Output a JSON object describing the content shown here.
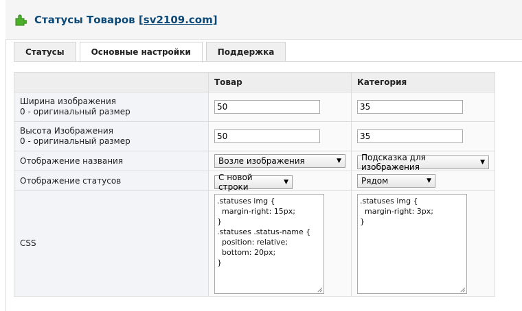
{
  "header": {
    "title": "Статусы Товаров",
    "link": "[sv2109.com]"
  },
  "tabs": [
    {
      "label": "Статусы",
      "active": false
    },
    {
      "label": "Основные настройки",
      "active": true
    },
    {
      "label": "Поддержка",
      "active": false
    }
  ],
  "table": {
    "columns": [
      "",
      "Товар",
      "Категория"
    ],
    "rows": {
      "width": {
        "label1": "Ширина изображения",
        "label2": "0 - оригинальный размер",
        "product": "50",
        "category": "35"
      },
      "height": {
        "label1": "Высота Изображения",
        "label2": "0 - оригинальный размер",
        "product": "50",
        "category": "35"
      },
      "name_display": {
        "label": "Отображение названия",
        "product": "Возле изображения",
        "category": "Подсказка для изображения"
      },
      "status_display": {
        "label": "Отображение статусов",
        "product": "С новой строки",
        "category": "Рядом"
      },
      "css": {
        "label": "CSS",
        "product": ".statuses img {\n  margin-right: 15px;\n}\n.statuses .status-name {\n  position: relative;\n  bottom: 20px;\n}",
        "category": ".statuses img {\n  margin-right: 3px;\n}"
      }
    }
  },
  "icons": {
    "header": "puzzle-piece-icon",
    "select": "dropdown-arrow-icon",
    "resize": "resize-grip-icon"
  },
  "colors": {
    "title": "#0e4a78",
    "puzzle": "#4caf2a",
    "label_bg": "#f3f4f8",
    "header_bg": "#eeeeee"
  }
}
